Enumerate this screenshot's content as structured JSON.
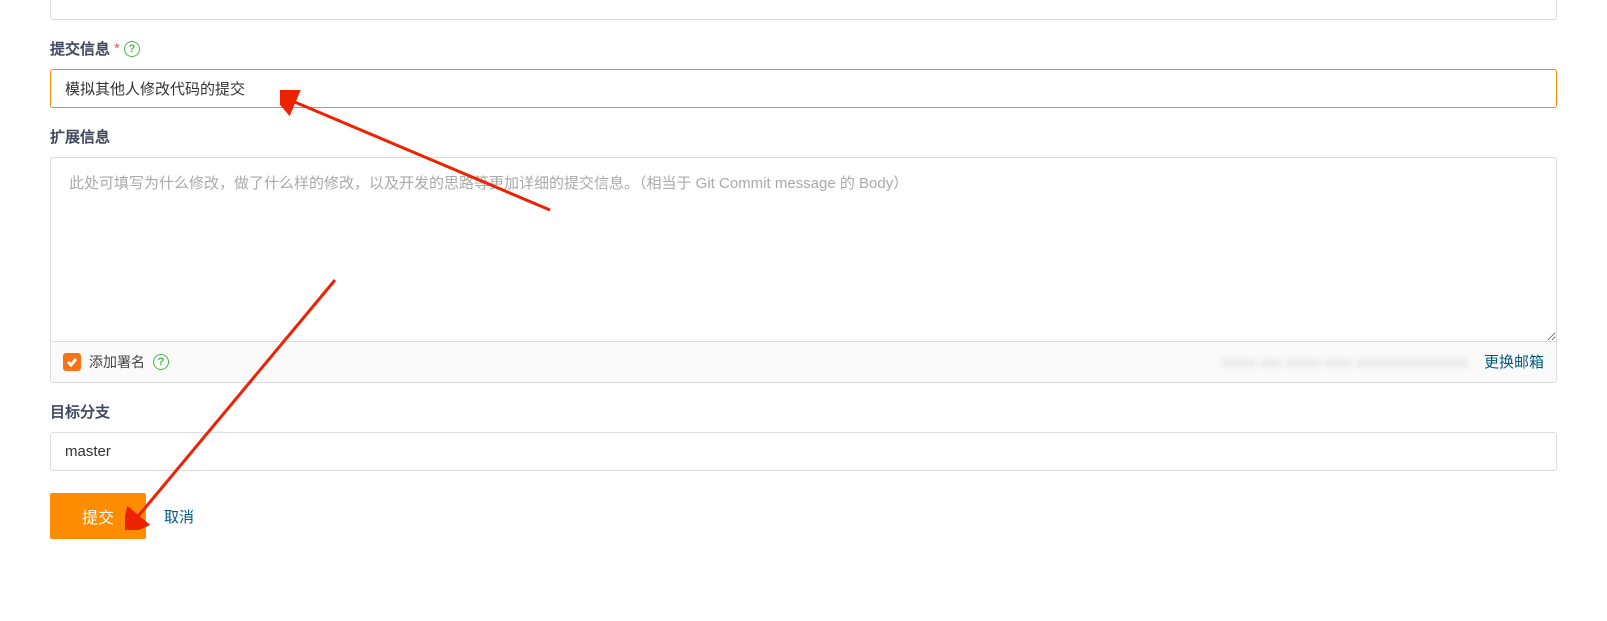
{
  "commit_message": {
    "label": "提交信息",
    "required_mark": "*",
    "value": "模拟其他人修改代码的提交"
  },
  "extended_info": {
    "label": "扩展信息",
    "placeholder": "此处可填写为什么修改，做了什么样的修改，以及开发的思路等更加详细的提交信息。（相当于 Git Commit message 的 Body）",
    "value": ""
  },
  "signature": {
    "checkbox_checked": true,
    "label": "添加署名",
    "email_blurred": "xxxxx xxx xxxxx xxxx xxxxxxxxxxxxxxxx",
    "change_email_label": "更换邮箱"
  },
  "target_branch": {
    "label": "目标分支",
    "value": "master"
  },
  "buttons": {
    "submit": "提交",
    "cancel": "取消"
  }
}
